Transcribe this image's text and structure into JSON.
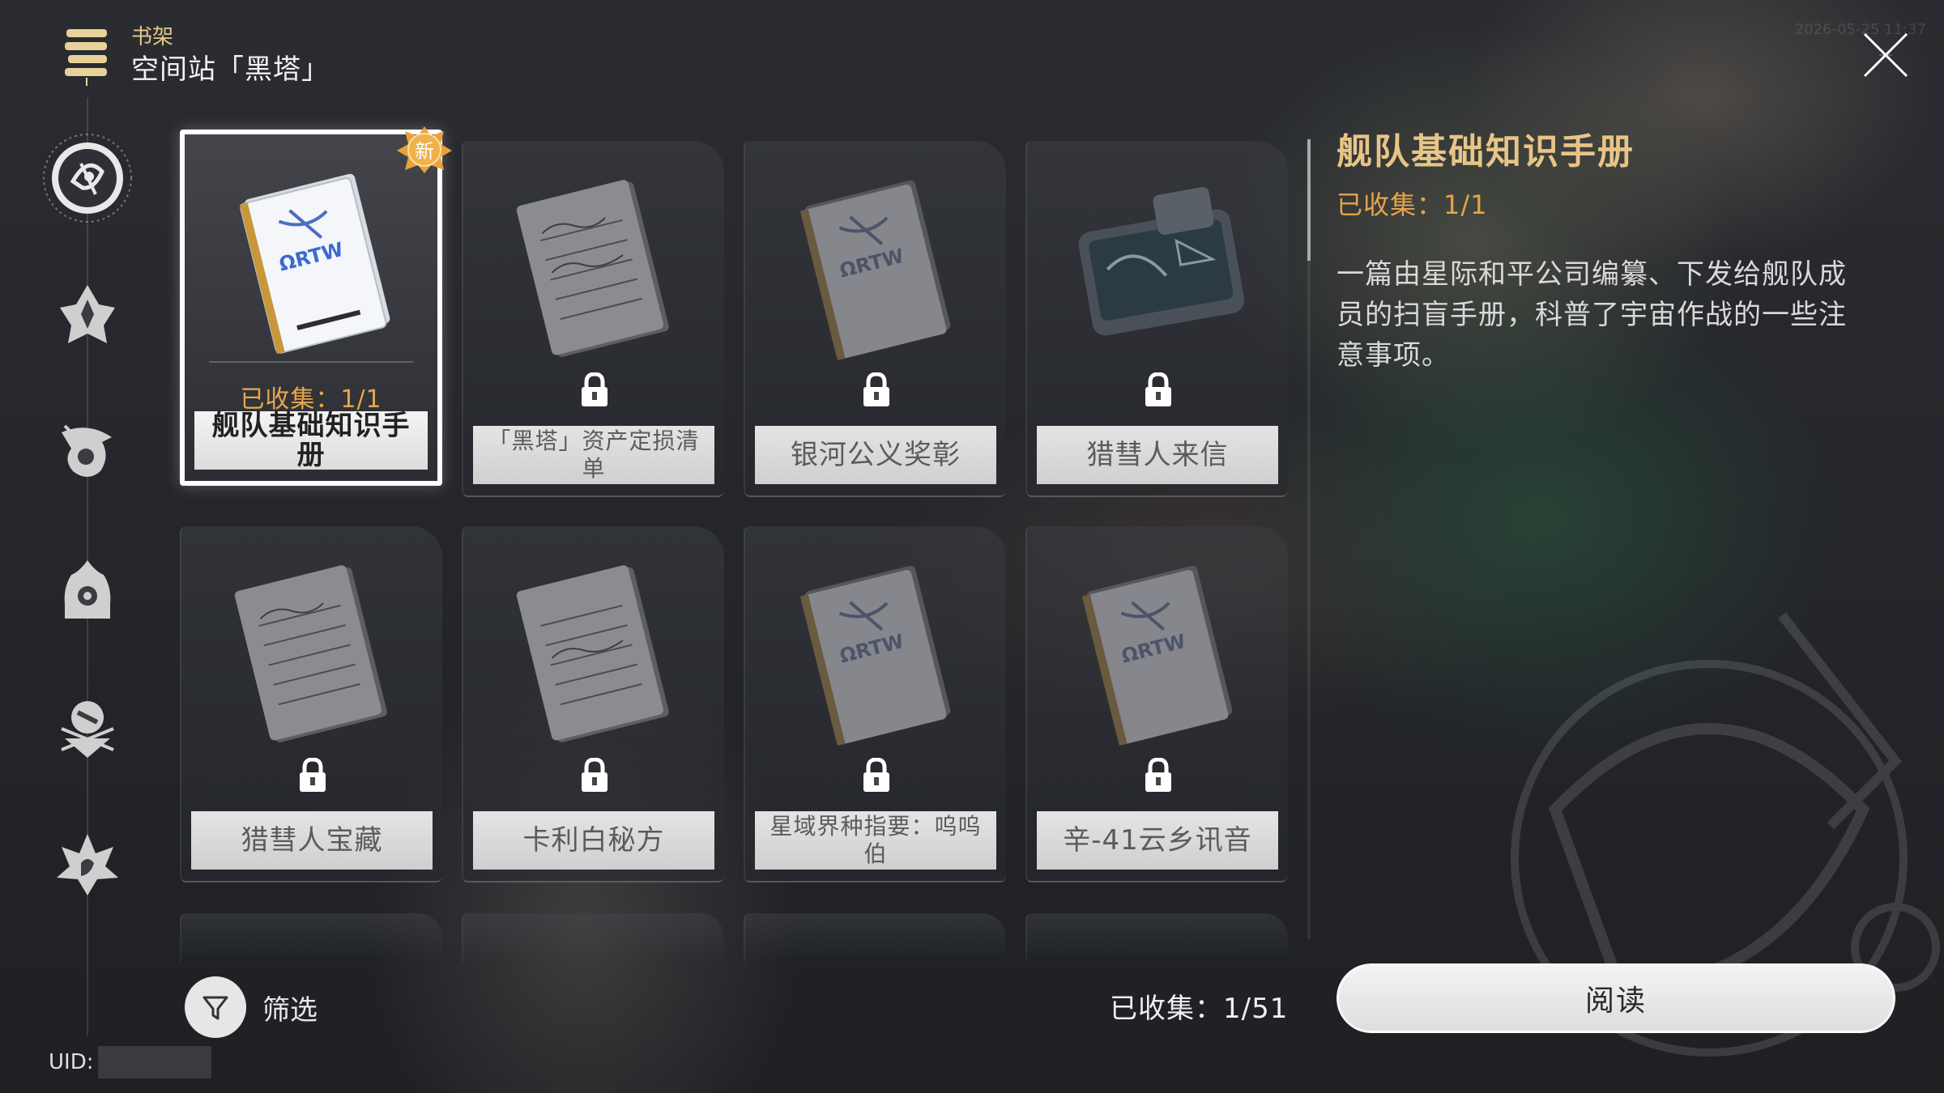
{
  "header": {
    "section": "书架",
    "title": "空间站「黑塔」"
  },
  "timestamp": "2026-05-25 11:37",
  "rail": {
    "items": [
      {
        "name": "rail-item-herta-station",
        "icon": "herta-station-icon",
        "active": true
      },
      {
        "name": "rail-item-jarilo",
        "icon": "jarilo-icon",
        "active": false
      },
      {
        "name": "rail-item-xianzhou",
        "icon": "xianzhou-icon",
        "active": false
      },
      {
        "name": "rail-item-penacony",
        "icon": "penacony-icon",
        "active": false
      },
      {
        "name": "rail-item-misc",
        "icon": "misc-icon",
        "active": false
      },
      {
        "name": "rail-item-other",
        "icon": "other-icon",
        "active": false
      }
    ]
  },
  "books": [
    {
      "name": "舰队基础知识手册",
      "collected": "已收集：1/1",
      "locked": false,
      "selected": true,
      "new": "新",
      "cover": "manual"
    },
    {
      "name": "「黑塔」资产定损清单",
      "locked": true,
      "cover": "notes"
    },
    {
      "name": "银河公义奖彰",
      "locked": true,
      "cover": "manual"
    },
    {
      "name": "猎彗人来信",
      "locked": true,
      "cover": "tablet"
    },
    {
      "name": "猎彗人宝藏",
      "locked": true,
      "cover": "notes"
    },
    {
      "name": "卡利白秘方",
      "locked": true,
      "cover": "notes"
    },
    {
      "name": "星域界种指要：呜呜伯",
      "locked": true,
      "cover": "manual"
    },
    {
      "name": "辛-41云乡讯音",
      "locked": true,
      "cover": "manual"
    }
  ],
  "detail": {
    "title": "舰队基础知识手册",
    "collected": "已收集：1/1",
    "description": "一篇由星际和平公司编纂、下发给舰队成员的扫盲手册，科普了宇宙作战的一些注意事项。"
  },
  "footer": {
    "filter_label": "筛选",
    "total": "已收集：1/51",
    "read_label": "阅读",
    "uid_label": "UID:"
  },
  "colors": {
    "gold": "#e8c586",
    "orange": "#e7a34a",
    "badge": "#e9a23a"
  }
}
